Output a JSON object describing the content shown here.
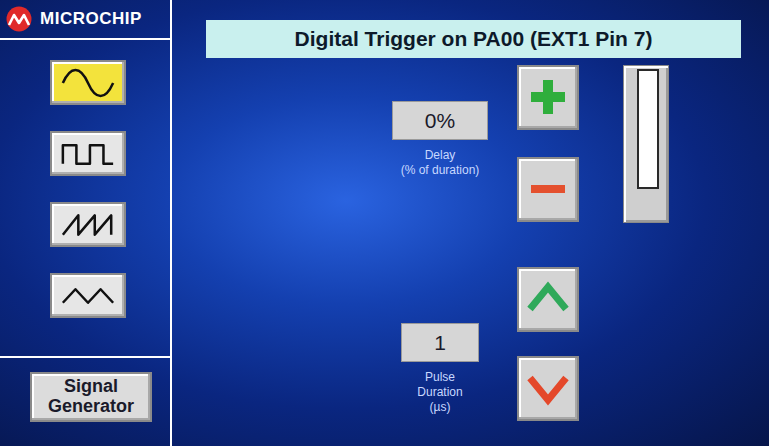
{
  "logo": {
    "text": "MICROCHIP"
  },
  "waveforms": [
    {
      "kind": "sine",
      "selected": true
    },
    {
      "kind": "square",
      "selected": false
    },
    {
      "kind": "sawtooth",
      "selected": false
    },
    {
      "kind": "triangle",
      "selected": false
    }
  ],
  "mode_button": {
    "lines": [
      "Signal",
      "Generator"
    ]
  },
  "title": "Digital Trigger on PA00 (EXT1 Pin 7)",
  "delay": {
    "value": "0%",
    "label_lines": [
      "Delay",
      "(% of duration)"
    ]
  },
  "slider": {
    "level": 0
  },
  "pulse": {
    "value": "1",
    "label_lines": [
      "Pulse",
      "Duration",
      "(µs)"
    ]
  }
}
